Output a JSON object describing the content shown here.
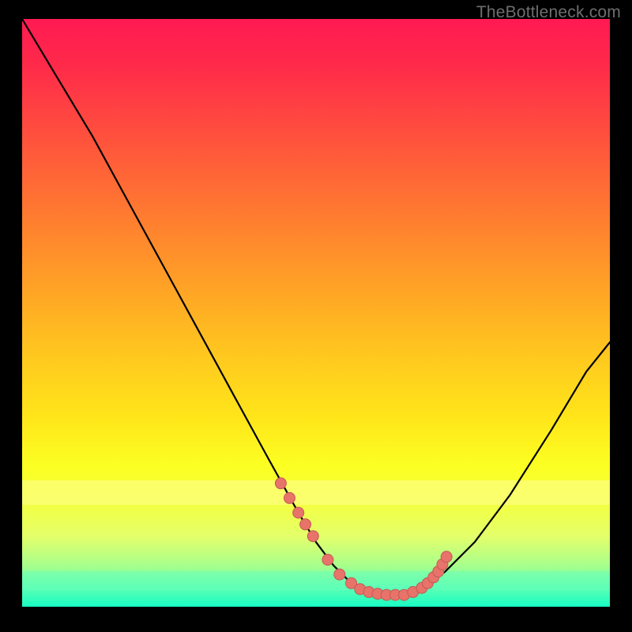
{
  "watermark": "TheBottleneck.com",
  "colors": {
    "curve": "#000000",
    "marker_fill": "#e8736a",
    "marker_stroke": "#c25a52",
    "band_yellow": "rgba(255,255,150,0.55)",
    "band_green": "rgba(100,255,190,0.45)"
  },
  "chart_data": {
    "type": "line",
    "title": "",
    "xlabel": "",
    "ylabel": "",
    "xlim": [
      0,
      100
    ],
    "ylim": [
      0,
      100
    ],
    "grid": false,
    "legend": false,
    "note": "V-shaped bottleneck curve; y≈0 around x≈55–65; left branch reaches y≈100 at x≈0; right branch reaches y≈45 at x=100. Values read off the figure by relative position; no axis labels present.",
    "series": [
      {
        "name": "bottleneck-curve",
        "x": [
          0,
          6,
          12,
          18,
          24,
          30,
          36,
          42,
          47,
          50,
          53,
          56,
          59,
          62,
          65,
          68,
          72,
          77,
          83,
          90,
          96,
          100
        ],
        "y": [
          100,
          90,
          80,
          69,
          58,
          47,
          36,
          25,
          16,
          11,
          7,
          4,
          2.5,
          2,
          2,
          3,
          6,
          11,
          19,
          30,
          40,
          45
        ]
      }
    ],
    "markers": {
      "name": "highlight-points",
      "note": "clustered salmon dots near valley and lower branches",
      "x": [
        44,
        45.5,
        47,
        48.2,
        49.5,
        52,
        54,
        56,
        57.5,
        59,
        60.5,
        62,
        63.5,
        65,
        66.5,
        68,
        69,
        70,
        70.8,
        71.5,
        72.2
      ],
      "y": [
        21,
        18.5,
        16,
        14,
        12,
        8,
        5.5,
        4,
        3,
        2.5,
        2.2,
        2,
        2,
        2,
        2.5,
        3.2,
        4,
        5,
        6,
        7.2,
        8.5
      ]
    }
  }
}
